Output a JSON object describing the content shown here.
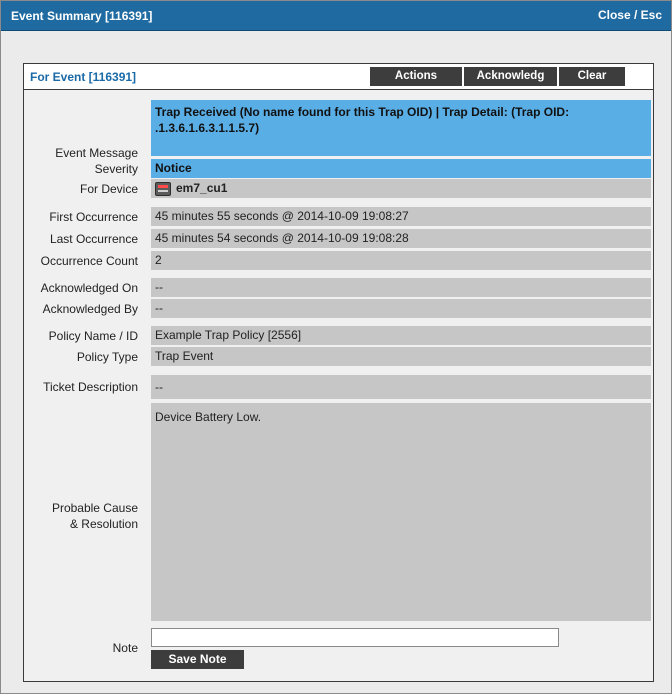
{
  "window": {
    "title": "Event Summary [116391]",
    "close_label": "Close / Esc"
  },
  "panel": {
    "title": "For Event [116391]",
    "buttons": {
      "actions": "Actions",
      "acknowledge": "Acknowledg",
      "clear": "Clear"
    }
  },
  "fields": {
    "event_message": {
      "label": "Event Message",
      "line1": "Trap Received (No name found for this Trap OID) | Trap Detail: (Trap OID:",
      "line2": ".1.3.6.1.6.3.1.1.5.7)"
    },
    "severity": {
      "label": "Severity",
      "value": "Notice"
    },
    "for_device": {
      "label": "For Device",
      "value": "em7_cu1",
      "icon": "device-icon"
    },
    "first_occurrence": {
      "label": "First Occurrence",
      "value": "45 minutes 55 seconds @ 2014-10-09 19:08:27"
    },
    "last_occurrence": {
      "label": "Last Occurrence",
      "value": "45 minutes 54 seconds @ 2014-10-09 19:08:28"
    },
    "occurrence_count": {
      "label": "Occurrence Count",
      "value": "2"
    },
    "acknowledged_on": {
      "label": "Acknowledged On",
      "value": "--"
    },
    "acknowledged_by": {
      "label": "Acknowledged By",
      "value": "--"
    },
    "policy_name": {
      "label": "Policy Name / ID",
      "value": "Example Trap Policy [2556]"
    },
    "policy_type": {
      "label": "Policy Type",
      "value": "Trap Event"
    },
    "ticket_description": {
      "label": "Ticket Description",
      "value": "--"
    },
    "probable_cause": {
      "label_line1": "Probable Cause",
      "label_line2": "& Resolution",
      "value": "Device Battery Low."
    }
  },
  "note": {
    "label": "Note",
    "value": "",
    "save_label": "Save Note"
  },
  "colors": {
    "titlebar": "#1f6aa0",
    "highlight": "#5aaee6",
    "value_bg": "#c6c6c6",
    "button_bg": "#3d3d3d",
    "panel_title": "#1a6aa8"
  }
}
